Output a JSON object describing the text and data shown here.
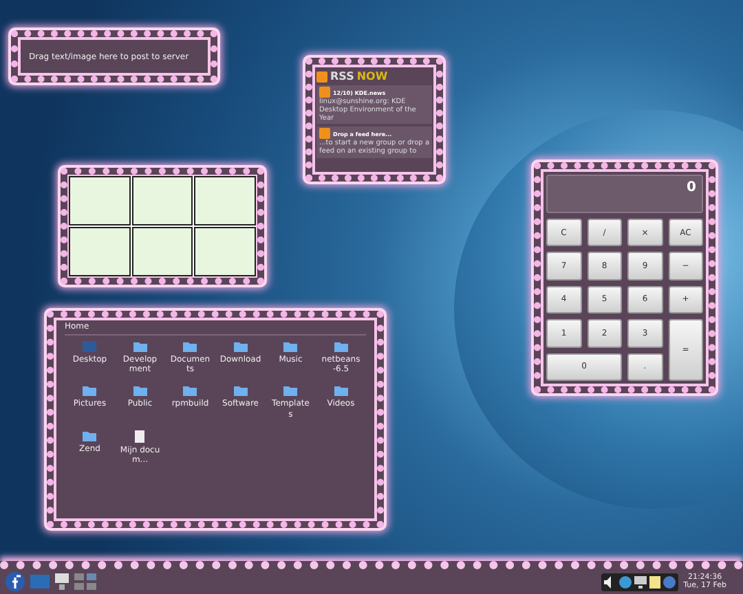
{
  "paste_widget": {
    "text": "Drag text/image here to post to server"
  },
  "rss_widget": {
    "logo_first": "RSS",
    "logo_second": "NOW",
    "items": [
      {
        "title": "12/10) KDE.news",
        "summary": "linux@sunshine.org: KDE Desktop Environment of the Year"
      },
      {
        "title": "Drop a feed here...",
        "summary": "...to start a new group or drop a feed on an existing group to"
      }
    ]
  },
  "calculator": {
    "display": "0",
    "keys": [
      {
        "label": "C",
        "kind": "normal"
      },
      {
        "label": "/",
        "kind": "normal"
      },
      {
        "label": "×",
        "kind": "normal"
      },
      {
        "label": "AC",
        "kind": "normal"
      },
      {
        "label": "7",
        "kind": "normal"
      },
      {
        "label": "8",
        "kind": "normal"
      },
      {
        "label": "9",
        "kind": "normal"
      },
      {
        "label": "−",
        "kind": "normal"
      },
      {
        "label": "4",
        "kind": "normal"
      },
      {
        "label": "5",
        "kind": "normal"
      },
      {
        "label": "6",
        "kind": "normal"
      },
      {
        "label": "+",
        "kind": "normal"
      },
      {
        "label": "1",
        "kind": "normal"
      },
      {
        "label": "2",
        "kind": "normal"
      },
      {
        "label": "3",
        "kind": "normal"
      },
      {
        "label": "=",
        "kind": "tall"
      },
      {
        "label": "0",
        "kind": "wide"
      },
      {
        "label": ".",
        "kind": "normal"
      }
    ]
  },
  "folder_view": {
    "title": "Home",
    "items": [
      {
        "name": "Desktop",
        "kind": "desktop"
      },
      {
        "name": "Development",
        "kind": "folder"
      },
      {
        "name": "Documents",
        "kind": "folder"
      },
      {
        "name": "Download",
        "kind": "folder"
      },
      {
        "name": "Music",
        "kind": "folder"
      },
      {
        "name": "netbeans-6.5",
        "kind": "folder"
      },
      {
        "name": "Pictures",
        "kind": "folder"
      },
      {
        "name": "Public",
        "kind": "folder"
      },
      {
        "name": "rpmbuild",
        "kind": "folder"
      },
      {
        "name": "Software",
        "kind": "folder"
      },
      {
        "name": "Templates",
        "kind": "folder"
      },
      {
        "name": "Videos",
        "kind": "folder"
      },
      {
        "name": "Zend",
        "kind": "folder"
      },
      {
        "name": "Mijn docum...",
        "kind": "file"
      }
    ]
  },
  "panel": {
    "clock_time": "21:24:36",
    "clock_date": "Tue, 17 Feb"
  }
}
